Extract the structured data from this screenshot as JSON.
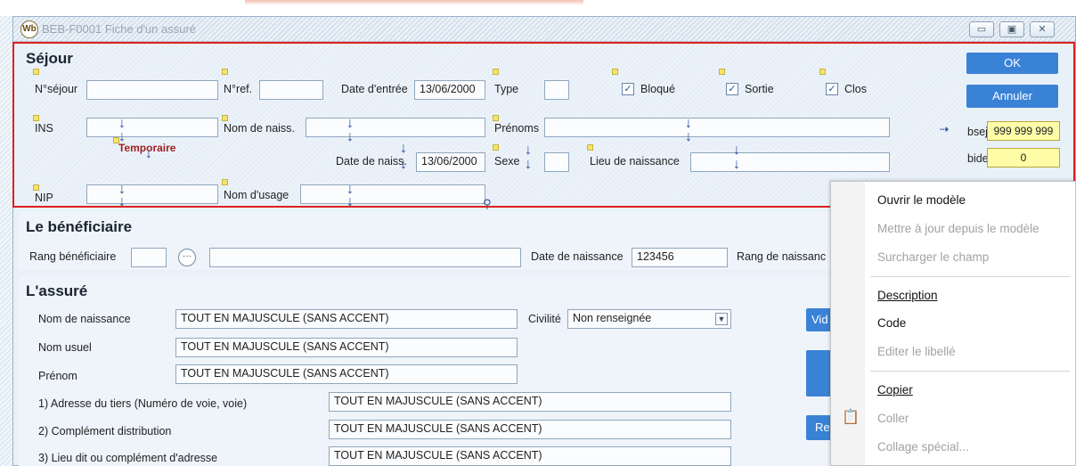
{
  "window": {
    "title": "BEB-F0001 Fiche d'un assuré",
    "app_icon_text": "Wb"
  },
  "sejour": {
    "section_title": "Séjour",
    "nsejour_label": "N°séjour",
    "nref_label": "N°ref.",
    "date_entree_label": "Date d'entrée",
    "date_entree_value": "13/06/2000",
    "type_label": "Type",
    "bloque_label": "Bloqué",
    "sortie_label": "Sortie",
    "clos_label": "Clos",
    "ins_label": "INS",
    "nom_naiss_label": "Nom de naiss.",
    "prenoms_label": "Prénoms",
    "temporaire_label": "Temporaire",
    "date_naiss_label": "Date de naiss.",
    "date_naiss_value": "13/06/2000",
    "sexe_label": "Sexe",
    "lieu_naiss_label": "Lieu de naissance",
    "nip_label": "NIP",
    "nom_usage_label": "Nom d'usage"
  },
  "right_panel": {
    "ok_label": "OK",
    "annuler_label": "Annuler",
    "bsej_label": "bsej",
    "bsej_value": "999 999 999",
    "bide_label": "bide",
    "bide_value": "0"
  },
  "beneficiaire": {
    "section_title": "Le bénéficiaire",
    "rang_label": "Rang bénéficiaire",
    "date_naiss_label": "Date de naissance",
    "date_naiss_value": "123456",
    "rang_naiss_label": "Rang de naissanc"
  },
  "assure": {
    "section_title": "L'assuré",
    "nom_naissance_label": "Nom de naissance",
    "nom_naissance_value": "TOUT EN MAJUSCULE (SANS ACCENT)",
    "civilite_label": "Civilité",
    "civilite_value": "Non renseignée",
    "nom_usuel_label": "Nom usuel",
    "nom_usuel_value": "TOUT EN MAJUSCULE (SANS ACCENT)",
    "prenom_label": "Prénom",
    "prenom_value": "TOUT EN MAJUSCULE (SANS ACCENT)",
    "adresse1_label": "1) Adresse du tiers (Numéro de voie, voie)",
    "adresse1_value": "TOUT EN MAJUSCULE (SANS ACCENT)",
    "adresse2_label": "2) Complément distribution",
    "adresse2_value": "TOUT EN MAJUSCULE (SANS ACCENT)",
    "adresse3_label": "3) Lieu dit ou complément d'adresse",
    "adresse3_value": "TOUT EN MAJUSCULE (SANS ACCENT)",
    "vid_label": "Vid",
    "re_label": "Re"
  },
  "context_menu": {
    "items": [
      {
        "label": "Ouvrir le modèle",
        "disabled": false
      },
      {
        "label": "Mettre à jour depuis le modèle",
        "disabled": true
      },
      {
        "label": "Surcharger le champ",
        "disabled": true
      },
      {
        "label": "Description",
        "disabled": false
      },
      {
        "label": "Code",
        "disabled": false
      },
      {
        "label": "Editer le libellé",
        "disabled": true
      },
      {
        "label": "Copier",
        "disabled": false
      },
      {
        "label": "Coller",
        "disabled": true
      },
      {
        "label": "Collage spécial...",
        "disabled": true
      }
    ]
  },
  "colors": {
    "highlight": "#e0201d",
    "button_blue": "#3a82d6",
    "yellow_field": "#fffca8"
  }
}
